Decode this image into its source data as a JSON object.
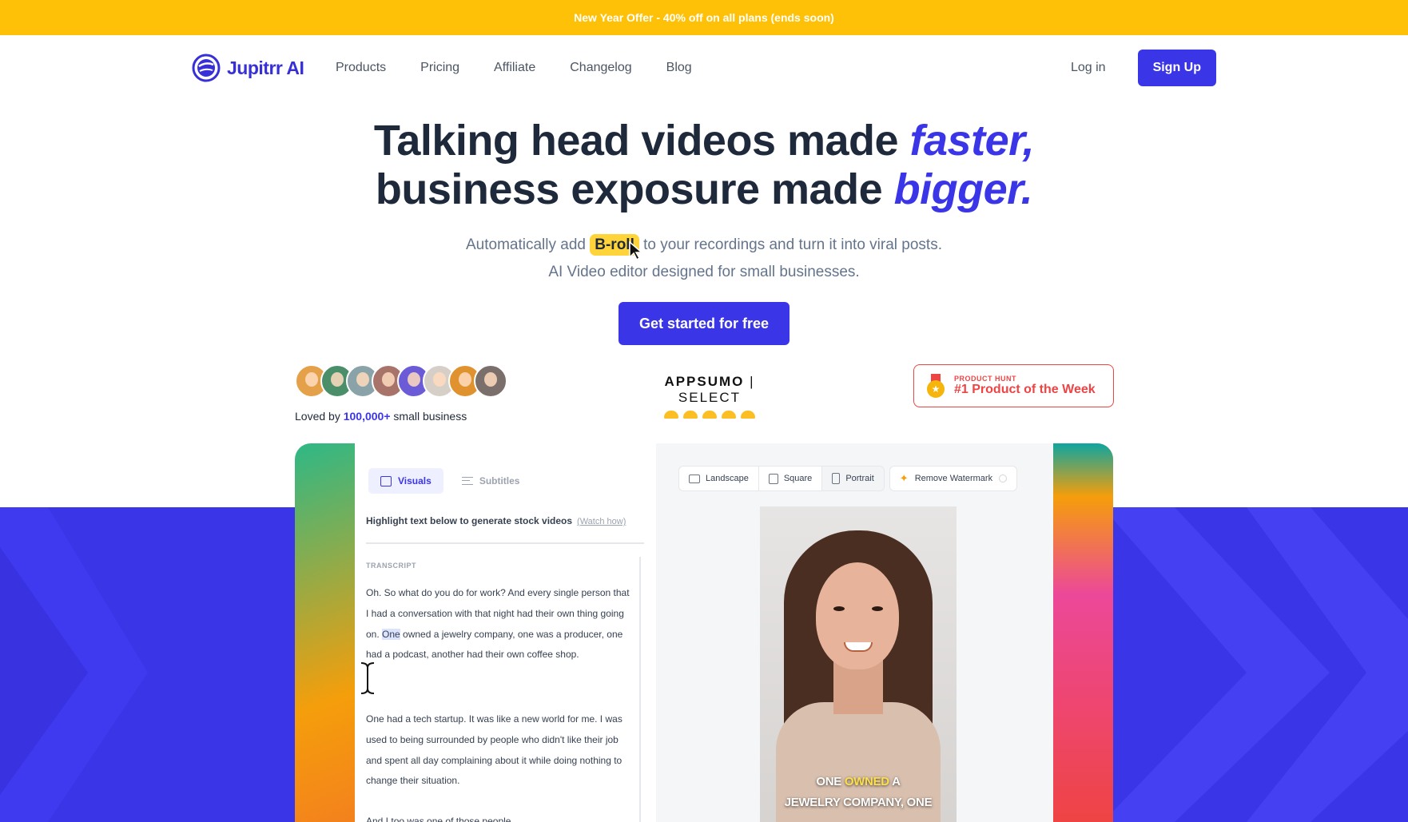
{
  "promo": {
    "text": "New Year Offer - 40% off on all plans (ends soon)"
  },
  "nav": {
    "brand": "Jupitrr AI",
    "links": [
      "Products",
      "Pricing",
      "Affiliate",
      "Changelog",
      "Blog"
    ],
    "login": "Log in",
    "signup": "Sign Up"
  },
  "hero": {
    "line1_plain": "Talking head videos made ",
    "line1_em": "faster,",
    "line2_plain": "business exposure made ",
    "line2_em": "bigger.",
    "sub1_a": "Automatically add ",
    "sub1_hl": "B-roll",
    "sub1_b": " to your recordings and turn it into viral posts.",
    "sub2": "AI Video editor designed for small businesses.",
    "cta": "Get started for free"
  },
  "social": {
    "loved_a": "Loved by ",
    "loved_count": "100,000+",
    "loved_b": " small business",
    "appsumo_brand": "APPSUMO",
    "appsumo_tag": "SELECT",
    "ph_small": "PRODUCT HUNT",
    "ph_big": "#1 Product of the Week"
  },
  "editor": {
    "tab_visuals": "Visuals",
    "tab_subtitles": "Subtitles",
    "instruction": "Highlight text below to generate stock videos",
    "watch": "(Watch how)",
    "transcript_label": "TRANSCRIPT",
    "para1_a": "Oh. So what do you do for work? And every single person that I had a conversation with that night had their own thing going on. ",
    "para1_sel": "One",
    "para1_b": " owned a jewelry company, one was a producer, one had a podcast, another had their own coffee shop.",
    "para2": "One had a tech startup. It was like a new world for me. I was used to being surrounded by people who didn't like their job and spent all day complaining about it while doing nothing to change their situation.",
    "para3": "And I too was one of those people."
  },
  "preview": {
    "landscape": "Landscape",
    "square": "Square",
    "portrait": "Portrait",
    "remove_watermark": "Remove Watermark",
    "caption_a": "ONE ",
    "caption_hl": "OWNED",
    "caption_b": " A",
    "caption_line2": "JEWELRY COMPANY, ONE"
  },
  "colors": {
    "accent": "#3b35e8",
    "promo_bar": "#ffc107",
    "highlight": "#ffd43b",
    "product_hunt": "#ef4444"
  }
}
